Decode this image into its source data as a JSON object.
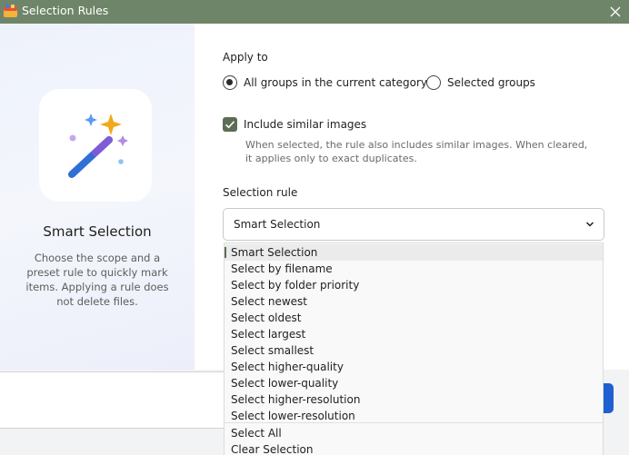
{
  "window": {
    "title": "Selection Rules"
  },
  "left_panel": {
    "title": "Smart Selection",
    "description": "Choose the scope and a preset rule to quickly mark items. Applying a rule does not delete files."
  },
  "apply_to": {
    "label": "Apply to",
    "options": [
      {
        "label": "All groups in the current category",
        "checked": true
      },
      {
        "label": "Selected groups",
        "checked": false
      }
    ]
  },
  "include_similar": {
    "label": "Include similar images",
    "checked": true,
    "hint": "When selected, the rule also includes similar images. When cleared, it applies only to exact duplicates."
  },
  "selection_rule": {
    "label": "Selection rule",
    "value": "Smart Selection",
    "options": [
      "Smart Selection",
      "Select by filename",
      "Select by folder priority",
      "Select newest",
      "Select oldest",
      "Select largest",
      "Select smallest",
      "Select higher-quality",
      "Select lower-quality",
      "Select higher-resolution",
      "Select lower-resolution"
    ],
    "extra_options": [
      "Select All",
      "Clear Selection"
    ]
  },
  "colors": {
    "titlebar": "#6f8569",
    "accent": "#5b6e55",
    "primary_button": "#1f5fd0"
  },
  "icons": [
    "app-icon",
    "close-icon",
    "magic-wand-icon",
    "chevron-down-icon",
    "checkmark-icon"
  ]
}
